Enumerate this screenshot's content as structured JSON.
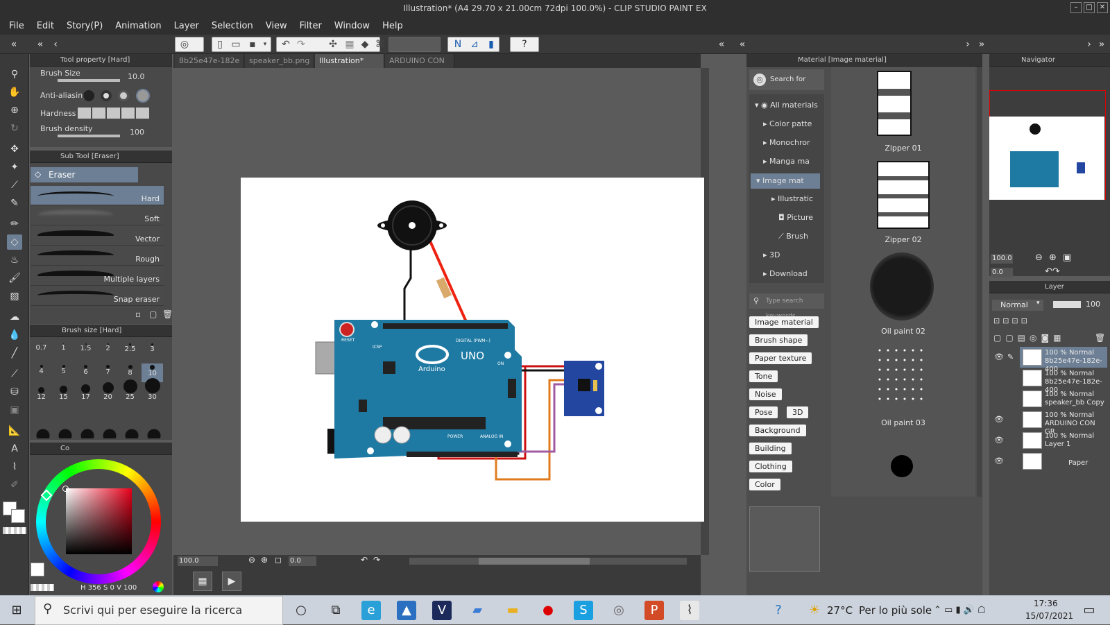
{
  "window": {
    "title": "Illustration* (A4 29.70 x 21.00cm 72dpi 100.0%)  - CLIP STUDIO PAINT EX"
  },
  "menu": [
    "File",
    "Edit",
    "Story(P)",
    "Animation",
    "Layer",
    "Selection",
    "View",
    "Filter",
    "Window",
    "Help"
  ],
  "tool_property": {
    "header": "Tool property [Hard]",
    "brush_size_label": "Brush Size",
    "brush_size_value": "10.0",
    "antialias_label": "Anti-aliasing",
    "hardness_label": "Hardness",
    "density_label": "Brush density",
    "density_value": "100"
  },
  "sub_tool": {
    "header": "Sub Tool [Eraser]",
    "group": "Eraser",
    "items": [
      "Hard",
      "Soft",
      "Vector",
      "Rough",
      "Multiple layers",
      "Snap eraser"
    ]
  },
  "brush_size_panel": {
    "header": "Brush size [Hard]",
    "values": [
      "0.7",
      "1",
      "1.5",
      "2",
      "2.5",
      "3",
      "4",
      "5",
      "6",
      "7",
      "8",
      "10",
      "12",
      "15",
      "17",
      "20",
      "25",
      "30"
    ]
  },
  "color": {
    "h": "356",
    "s": "0",
    "v": "100",
    "tab_label": "Co"
  },
  "tabs": [
    "8b25e47e-182e",
    "speaker_bb.png",
    "Illustration*",
    "ARDUINO CON"
  ],
  "canvas": {
    "zoom": "100.0",
    "angle": "0.0",
    "board": {
      "uno": "UNO",
      "brand": "Arduino",
      "reset": "RESET",
      "icsp": "ICSP",
      "digital": "DIGITAL (PWM~)",
      "power": "POWER",
      "analog": "ANALOG IN",
      "on": "ON"
    }
  },
  "material": {
    "header": "Material [Image material]",
    "search_label": "Search for Addition",
    "tree": [
      "All materials",
      "Color patte",
      "Monochror",
      "Manga ma",
      "Image mat",
      "Illustratic",
      "Picture",
      "Brush",
      "3D",
      "Download"
    ],
    "keyword_placeholder": "Type search keywords",
    "tags": [
      "Image material",
      "Brush shape",
      "Paper texture",
      "Tone",
      "Noise",
      "Pose",
      "3D",
      "Background",
      "Building",
      "Clothing",
      "Color"
    ],
    "items": [
      "Zipper 01",
      "Zipper 02",
      "Oil paint 02",
      "Oil paint 03"
    ]
  },
  "navigator": {
    "header": "Navigator",
    "zoom": "100.0",
    "angle": "0.0"
  },
  "layer_panel": {
    "header": "Layer",
    "blend": "Normal",
    "opacity": "100",
    "layers": [
      {
        "mode": "100 % Normal",
        "name": "8b25e47e-182e-400"
      },
      {
        "mode": "100 % Normal",
        "name": "8b25e47e-182e-400"
      },
      {
        "mode": "100 % Normal",
        "name": "speaker_bb Copy"
      },
      {
        "mode": "100 % Normal",
        "name": "ARDUINO CON GR"
      },
      {
        "mode": "100 % Normal",
        "name": "Layer 1"
      },
      {
        "mode": "",
        "name": "Paper"
      }
    ]
  },
  "taskbar": {
    "search_placeholder": "Scrivi qui per eseguire la ricerca",
    "weather_temp": "27°C",
    "weather_desc": "Per lo più sole",
    "time": "17:36",
    "date": "15/07/2021"
  },
  "colors": {
    "accent": "#6d7f95",
    "board": "#1f7aa3",
    "panel": "#494949"
  }
}
